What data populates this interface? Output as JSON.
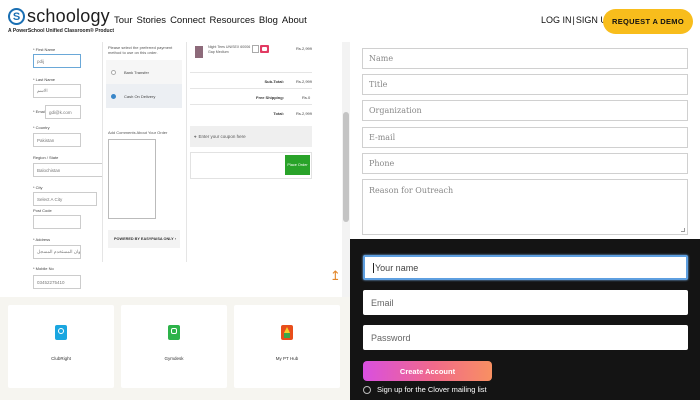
{
  "header": {
    "logo_letter": "S",
    "logo_text": "schoology",
    "logo_tagline": "A PowerSchool Unified Classroom® Product",
    "nav": [
      "Tour",
      "Stories",
      "Connect",
      "Resources",
      "Blog",
      "About"
    ],
    "login": "LOG IN",
    "separator": "|",
    "signup": "SIGN UP",
    "demo_button": "REQUEST A DEMO",
    "accent_color": "#f8bd1c"
  },
  "checkout": {
    "fields": [
      {
        "label": "* First Name",
        "value": "pdij"
      },
      {
        "label": "* Last Name",
        "value": "الاسم"
      },
      {
        "label": "* Email",
        "value": "gdi@k.com"
      },
      {
        "label": "* Country",
        "value": "Pakistan"
      },
      {
        "label": "Region / State",
        "value": "Balochistan"
      },
      {
        "label": "* City",
        "value": "Select A City"
      },
      {
        "label": "Post Code",
        "value": ""
      },
      {
        "label": "* Address",
        "value": "بيت عنوان المستخدم المسجل"
      },
      {
        "label": "* Mobile No",
        "value": "03452275410"
      }
    ],
    "payment_prompt": "Please select the preferred payment method to use on this order.",
    "payment_methods": [
      {
        "label": "Bank Transfer",
        "selected": false
      },
      {
        "label": "Cash On Delivery",
        "selected": true
      }
    ],
    "comments_label": "Add Comments About Your Order",
    "pay_note": "POWERED BY EASYPAISA ONLY ›",
    "product": {
      "name": "Night Tees UNISEX 60006 Gap Medium",
      "price": "Rs.2,999"
    },
    "summary": [
      {
        "label": "Sub-Total:",
        "value": "Rs.2,999"
      },
      {
        "label": "Free Shipping:",
        "value": "Rs.0"
      },
      {
        "label": "Total:",
        "value": "Rs.2,999"
      }
    ],
    "coupon_placeholder": "Enter your coupon here",
    "place_order": "Place Order"
  },
  "cards": [
    {
      "name": "ClubRight",
      "icon": "clubright-icon",
      "color": "#1aa6e0"
    },
    {
      "name": "Gymdesk",
      "icon": "gymdesk-icon",
      "color": "#2db34a"
    },
    {
      "name": "My PT Hub",
      "icon": "mypthub-icon",
      "color": "#e84e1b"
    }
  ],
  "outreach_form": {
    "fields": [
      "Name",
      "Title",
      "Organization",
      "E-mail",
      "Phone"
    ],
    "textarea_placeholder": "Reason for Outreach"
  },
  "signup_form": {
    "name_placeholder": "Your name",
    "email_placeholder": "Email",
    "password_placeholder": "Password",
    "create_button": "Create Account",
    "mailing_list": "Sign up for the Clover mailing list"
  }
}
